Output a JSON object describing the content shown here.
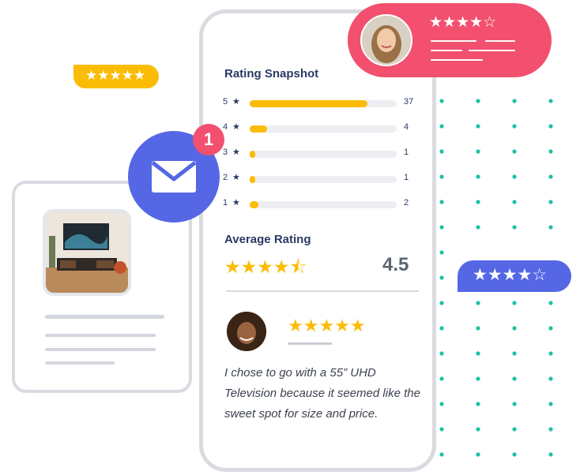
{
  "rating_snapshot": {
    "title": "Rating Snapshot",
    "rows": [
      {
        "stars": "5",
        "count": "37",
        "fill": 0.8
      },
      {
        "stars": "4",
        "count": "4",
        "fill": 0.12
      },
      {
        "stars": "3",
        "count": "1",
        "fill": 0.04
      },
      {
        "stars": "2",
        "count": "1",
        "fill": 0.04
      },
      {
        "stars": "1",
        "count": "2",
        "fill": 0.06
      }
    ]
  },
  "average": {
    "title": "Average Rating",
    "value": "4.5",
    "stars_glyphs": "★★★★⯪"
  },
  "review": {
    "stars_glyphs": "★★★★★",
    "text": "I chose to go with a 55” UHD Television because it seemed like the sweet spot for size and price."
  },
  "pink_card": {
    "stars_glyphs": "★★★★☆"
  },
  "yellow_bubble": {
    "stars_glyphs": "★★★★★"
  },
  "blue_bubble": {
    "stars_glyphs": "★★★★☆"
  },
  "notification": {
    "count": "1"
  },
  "colors": {
    "accent_yellow": "#fbbc05",
    "accent_pink": "#f2506e",
    "accent_blue": "#5567e5",
    "navy_text": "#2b3a67",
    "dots_teal": "#1cc1a5"
  }
}
